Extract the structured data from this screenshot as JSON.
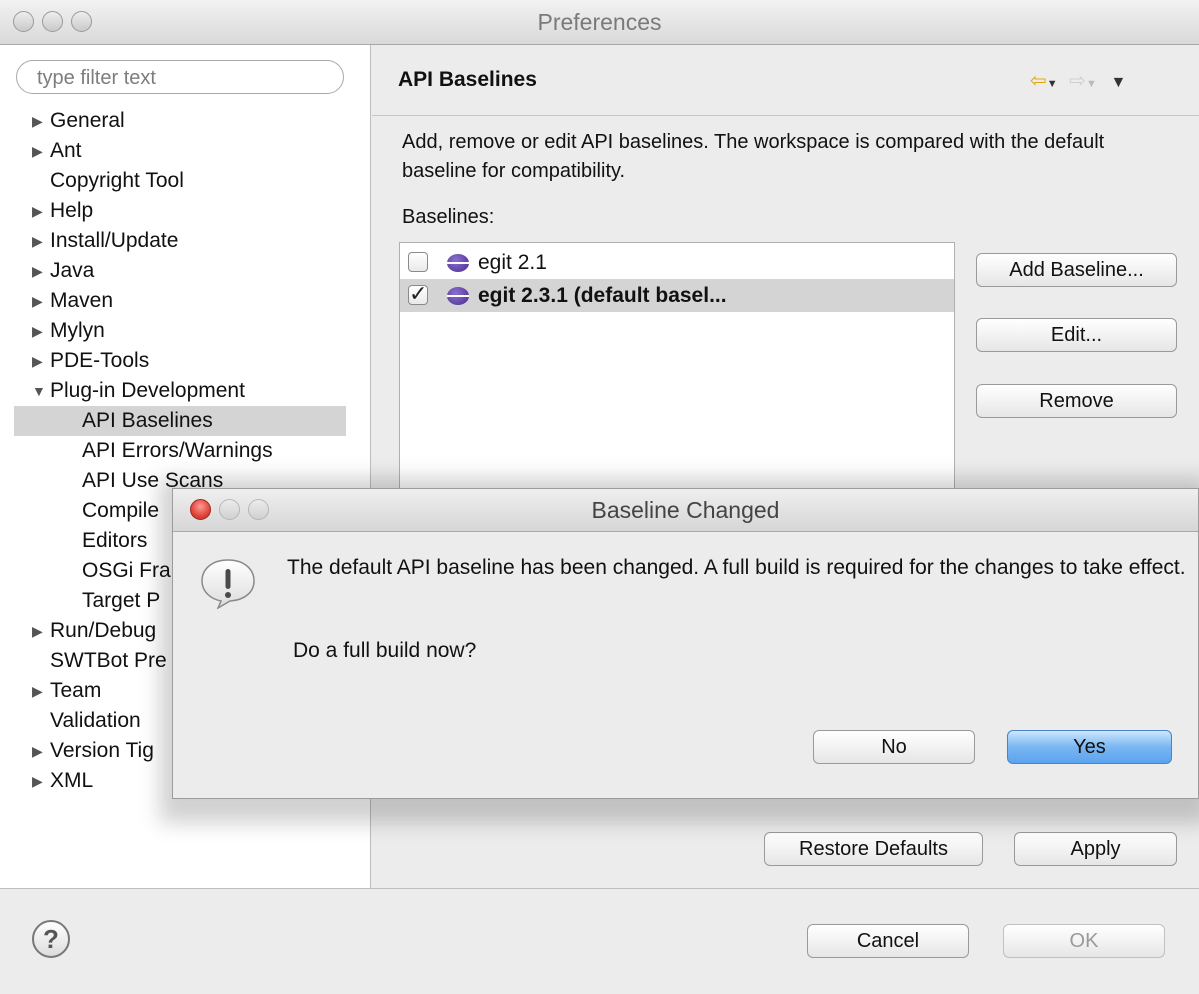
{
  "window": {
    "title": "Preferences"
  },
  "sidebar": {
    "filter_placeholder": "type filter text",
    "items": [
      {
        "label": "General",
        "arrow": "▶"
      },
      {
        "label": "Ant",
        "arrow": "▶"
      },
      {
        "label": "Copyright Tool",
        "arrow": ""
      },
      {
        "label": "Help",
        "arrow": "▶"
      },
      {
        "label": "Install/Update",
        "arrow": "▶"
      },
      {
        "label": "Java",
        "arrow": "▶"
      },
      {
        "label": "Maven",
        "arrow": "▶"
      },
      {
        "label": "Mylyn",
        "arrow": "▶"
      },
      {
        "label": "PDE-Tools",
        "arrow": "▶"
      },
      {
        "label": "Plug-in Development",
        "arrow": "▼"
      },
      {
        "label": "API Baselines",
        "arrow": ""
      },
      {
        "label": "API Errors/Warnings",
        "arrow": ""
      },
      {
        "label": "API Use Scans",
        "arrow": ""
      },
      {
        "label": "Compile",
        "arrow": ""
      },
      {
        "label": "Editors",
        "arrow": ""
      },
      {
        "label": "OSGi Fra",
        "arrow": ""
      },
      {
        "label": "Target P",
        "arrow": ""
      },
      {
        "label": "Run/Debug",
        "arrow": "▶"
      },
      {
        "label": "SWTBot Pre",
        "arrow": ""
      },
      {
        "label": "Team",
        "arrow": "▶"
      },
      {
        "label": "Validation",
        "arrow": ""
      },
      {
        "label": "Version Tig",
        "arrow": "▶"
      },
      {
        "label": "XML",
        "arrow": "▶"
      }
    ]
  },
  "pane": {
    "title": "API Baselines",
    "description": "Add, remove or edit API baselines. The workspace is compared with the default baseline for compatibility.",
    "baselines_label": "Baselines:",
    "baselines": [
      {
        "name": "egit 2.1",
        "checked": false
      },
      {
        "name": "egit 2.3.1  (default basel...",
        "checked": true
      }
    ],
    "buttons": {
      "add": "Add Baseline...",
      "edit": "Edit...",
      "remove": "Remove",
      "restore": "Restore Defaults",
      "apply": "Apply"
    }
  },
  "footer": {
    "help_icon": "?",
    "cancel": "Cancel",
    "ok": "OK"
  },
  "dialog": {
    "title": "Baseline Changed",
    "message": "The default API baseline has been changed. A full build is required for the changes to take effect.",
    "question": "Do a full build now?",
    "no": "No",
    "yes": "Yes"
  },
  "colors": {
    "selection": "#d4d4d4",
    "default_button": "#5ba3ee",
    "close_button": "#e0443a"
  }
}
